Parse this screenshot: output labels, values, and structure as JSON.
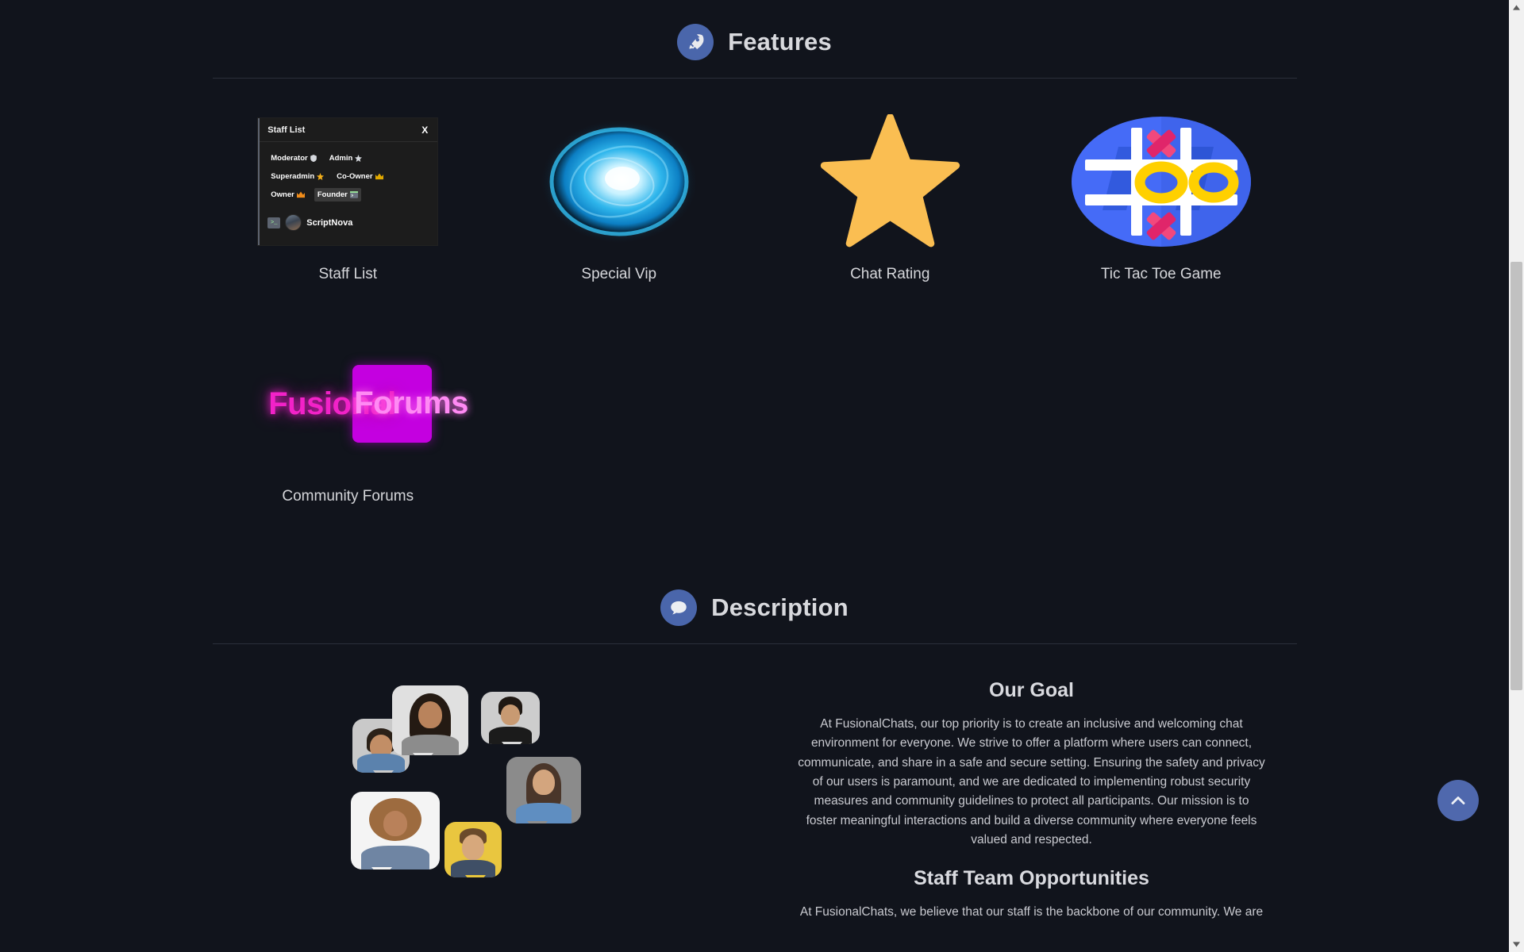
{
  "sections": {
    "features": {
      "title": "Features",
      "icon": "rocket-icon",
      "accent": "#4a66ab"
    },
    "description": {
      "title": "Description",
      "icon": "speech-bubble-icon",
      "accent": "#4a66ab"
    }
  },
  "features": [
    {
      "label": "Staff List",
      "art": "staff-list-window"
    },
    {
      "label": "Special Vip",
      "art": "blue-energy-orb"
    },
    {
      "label": "Chat Rating",
      "art": "gold-star"
    },
    {
      "label": "Tic Tac Toe Game",
      "art": "tic-tac-toe-board"
    },
    {
      "label": "Community Forums",
      "art": "fusional-forums-logo"
    }
  ],
  "staff_list": {
    "window_title": "Staff List",
    "close_label": "X",
    "roles": [
      {
        "name": "Moderator",
        "icon": "shield",
        "active": false
      },
      {
        "name": "Admin",
        "icon": "star-grey",
        "active": false
      },
      {
        "name": "Superadmin",
        "icon": "star-gold",
        "active": false
      },
      {
        "name": "Co-Owner",
        "icon": "crown-gold",
        "active": false
      },
      {
        "name": "Owner",
        "icon": "crown-orange",
        "active": false
      },
      {
        "name": "Founder",
        "icon": "terminal",
        "active": true
      }
    ],
    "members": [
      {
        "name": "ScriptNova",
        "badge": "terminal-badge"
      }
    ]
  },
  "forums_logo": {
    "word1": "Fusional",
    "word2": "Forums",
    "word1_color": "#f222c8",
    "word2_color": "#ff8af4",
    "plate_color": "#c400e0"
  },
  "description": {
    "blocks": [
      {
        "heading": "Our Goal",
        "body": "At FusionalChats, our top priority is to create an inclusive and welcoming chat environment for everyone. We strive to offer a platform where users can connect, communicate, and share in a safe and secure setting. Ensuring the safety and privacy of our users is paramount, and we are dedicated to implementing robust security measures and community guidelines to protect all participants. Our mission is to foster meaningful interactions and build a diverse community where everyone feels valued and respected."
      },
      {
        "heading": "Staff Team Opportunities",
        "body": "At FusionalChats, we believe that our staff is the backbone of our community. We are"
      }
    ]
  },
  "controls": {
    "scroll_top_label": "Scroll to top",
    "scroll_top_icon": "chevron-up-icon",
    "scrollbar_down_icon": "triangle-down-icon",
    "scrollbar_up_icon": "triangle-up-icon"
  },
  "colors": {
    "page_bg": "#11141c",
    "accent_blue": "#4f68ad",
    "star_gold": "#fabe52",
    "orb_blue": "#29a8e0",
    "ttt_blue": "#3f63f0",
    "ttt_yellow": "#ffd000",
    "ttt_pink": "#f2487d",
    "text_primary": "#d8d9dd",
    "text_body": "#c9cad0"
  }
}
